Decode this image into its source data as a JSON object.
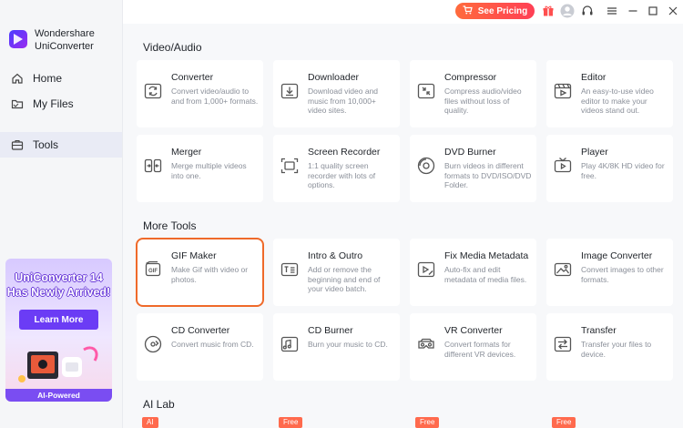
{
  "brand": {
    "line1": "Wondershare",
    "line2": "UniConverter"
  },
  "nav": [
    {
      "label": "Home",
      "icon": "home-icon"
    },
    {
      "label": "My Files",
      "icon": "folder-icon"
    },
    {
      "label": "Tools",
      "icon": "toolbox-icon",
      "active": true
    }
  ],
  "promo": {
    "title_line1": "UniConverter 14",
    "title_line2": "Has Newly Arrived!",
    "button": "Learn More",
    "footer": "AI-Powered"
  },
  "topbar": {
    "pricing": "See Pricing"
  },
  "sections": {
    "video_audio": "Video/Audio",
    "more_tools": "More Tools",
    "ai_lab": "AI Lab"
  },
  "cards": [
    {
      "title": "Converter",
      "desc": "Convert video/audio to and from 1,000+ formats.",
      "icon": "convert-icon"
    },
    {
      "title": "Downloader",
      "desc": "Download video and music from 10,000+ video sites.",
      "icon": "download-icon"
    },
    {
      "title": "Compressor",
      "desc": "Compress audio/video files without loss of quality.",
      "icon": "compress-icon"
    },
    {
      "title": "Editor",
      "desc": "An easy-to-use video editor to make your videos stand out.",
      "icon": "editor-icon"
    },
    {
      "title": "Merger",
      "desc": "Merge multiple videos into one.",
      "icon": "merge-icon"
    },
    {
      "title": "Screen Recorder",
      "desc": "1:1 quality screen recorder with lots of options.",
      "icon": "screen-record-icon"
    },
    {
      "title": "DVD Burner",
      "desc": "Burn videos in different formats to DVD/ISO/DVD Folder.",
      "icon": "dvd-icon"
    },
    {
      "title": "Player",
      "desc": "Play 4K/8K HD video for free.",
      "icon": "player-icon"
    },
    {
      "title": "GIF Maker",
      "desc": "Make Gif with video or photos.",
      "icon": "gif-icon",
      "highlight": true
    },
    {
      "title": "Intro & Outro",
      "desc": "Add or remove the beginning and end of your video batch.",
      "icon": "intro-outro-icon"
    },
    {
      "title": "Fix Media Metadata",
      "desc": "Auto-fix and edit metadata of media files.",
      "icon": "metadata-icon"
    },
    {
      "title": "Image Converter",
      "desc": "Convert images to other formats.",
      "icon": "image-convert-icon"
    },
    {
      "title": "CD Converter",
      "desc": "Convert music from CD.",
      "icon": "cd-convert-icon"
    },
    {
      "title": "CD Burner",
      "desc": "Burn your music to CD.",
      "icon": "cd-burn-icon"
    },
    {
      "title": "VR Converter",
      "desc": "Convert formats for different VR devices.",
      "icon": "vr-icon"
    },
    {
      "title": "Transfer",
      "desc": "Transfer your files to device.",
      "icon": "transfer-icon"
    }
  ],
  "ai_tags": [
    "AI",
    "Free",
    "Free",
    "Free"
  ],
  "colors": {
    "accent": "#6b3cf5",
    "highlight": "#ef6a2a",
    "pricing": "#ff4f4f"
  }
}
